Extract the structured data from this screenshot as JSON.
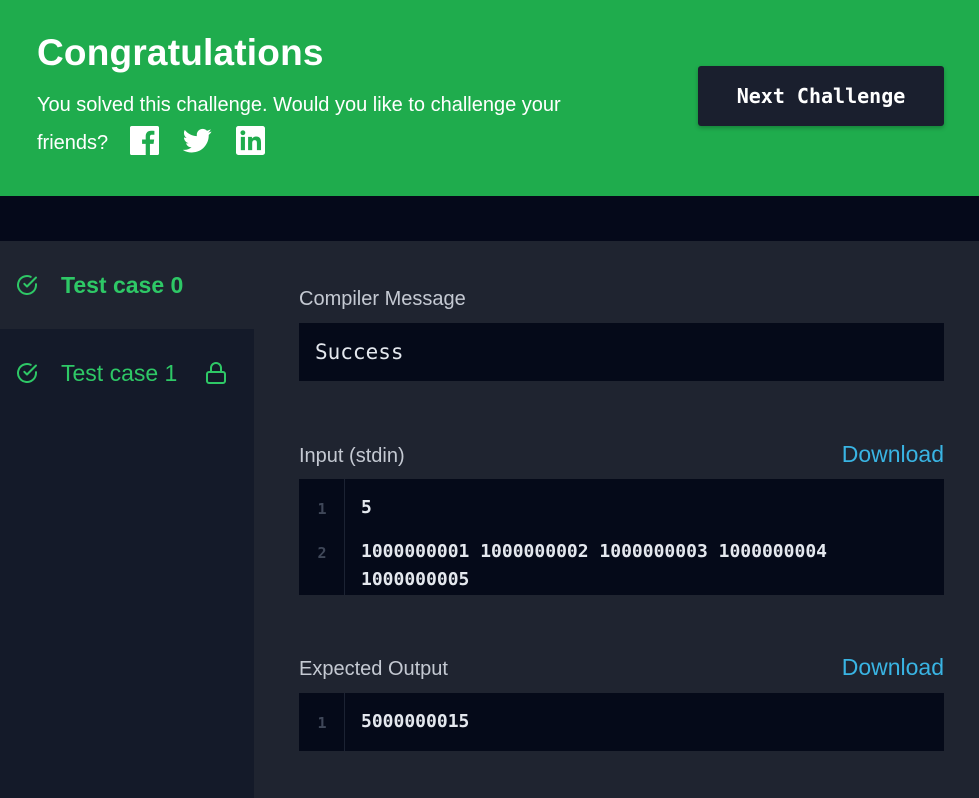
{
  "banner": {
    "title": "Congratulations",
    "message": "You solved this challenge. Would you like to challenge your friends?",
    "share": [
      {
        "icon": "facebook-icon"
      },
      {
        "icon": "twitter-icon"
      },
      {
        "icon": "linkedin-icon"
      }
    ],
    "next_button": "Next Challenge",
    "color": "#1fac4d"
  },
  "sidebar": {
    "test_cases": [
      {
        "label": "Test case 0",
        "status": "passed",
        "active": true,
        "locked": false
      },
      {
        "label": "Test case 1",
        "status": "passed",
        "active": false,
        "locked": true
      }
    ]
  },
  "main": {
    "compiler": {
      "label": "Compiler Message",
      "value": "Success"
    },
    "input": {
      "label": "Input (stdin)",
      "download": "Download",
      "lines": [
        {
          "num": "1",
          "text": "5"
        },
        {
          "num": "2",
          "text": "1000000001 1000000002 1000000003 1000000004 1000000005"
        }
      ]
    },
    "expected": {
      "label": "Expected Output",
      "download": "Download",
      "lines": [
        {
          "num": "1",
          "text": "5000000015"
        }
      ]
    }
  },
  "colors": {
    "accent_green": "#2ec866",
    "link_blue": "#39b4e3"
  }
}
